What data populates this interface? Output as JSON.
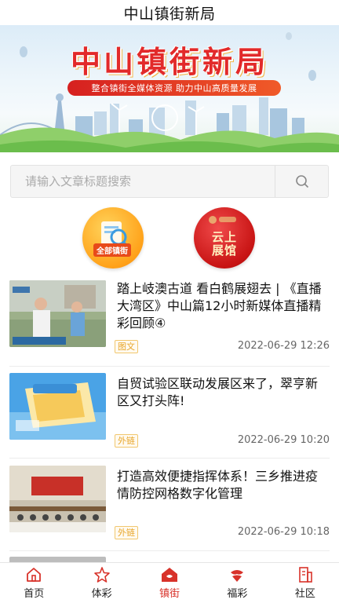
{
  "header": {
    "title": "中山镇街新局"
  },
  "banner": {
    "title": "中山镇街新局",
    "subtitle": "整合镇街全媒体资源  助力中山高质量发展"
  },
  "search": {
    "placeholder": "请输入文章标题搜索",
    "value": ""
  },
  "categories": [
    {
      "label": "全部镇街",
      "icon": "all-towns-icon"
    },
    {
      "label": "云上展馆",
      "icon": "cloud-exhibition-icon"
    }
  ],
  "news": [
    {
      "title": "踏上岐澳古道 看白鹤展翅去 | 《直播大湾区》中山篇12小时新媒体直播精彩回顾④",
      "tag": "图文",
      "time": "2022-06-29 12:26"
    },
    {
      "title": "自贸试验区联动发展区来了，翠亨新区又打头阵!",
      "tag": "外链",
      "time": "2022-06-29 10:20"
    },
    {
      "title": "打造高效便捷指挥体系！三乡推进疫情防控网格数字化管理",
      "tag": "外链",
      "time": "2022-06-29 10:18"
    }
  ],
  "tabs": [
    {
      "label": "首页",
      "icon": "home-icon",
      "active": false
    },
    {
      "label": "体彩",
      "icon": "sports-lottery-icon",
      "active": false
    },
    {
      "label": "镇街",
      "icon": "town-icon",
      "active": true
    },
    {
      "label": "福彩",
      "icon": "welfare-lottery-icon",
      "active": false
    },
    {
      "label": "社区",
      "icon": "community-icon",
      "active": false
    }
  ],
  "colors": {
    "accent": "#d8322a",
    "tag": "#e8a62a",
    "time": "#666666"
  }
}
